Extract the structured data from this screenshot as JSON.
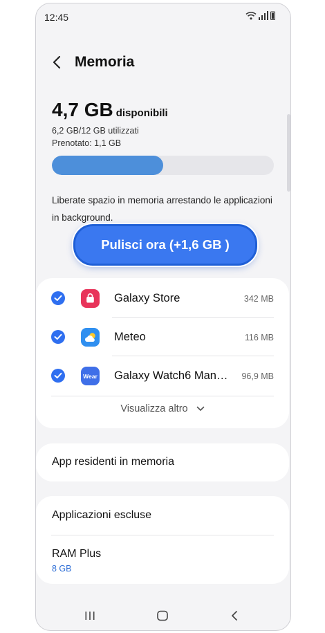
{
  "status_bar": {
    "time": "12:45"
  },
  "header": {
    "title": "Memoria"
  },
  "storage": {
    "available_value": "4,7 GB",
    "available_label": "disponibili",
    "used": "6,2 GB/12 GB utilizzati",
    "reserved": "Prenotato: 1,1 GB",
    "used_fraction": 0.5
  },
  "info_text": "Liberate spazio in memoria arrestando le applicazioni in background.",
  "clean_button": {
    "label": "Pulisci ora (+1,6 GB )"
  },
  "apps": [
    {
      "name": "Galaxy Store",
      "size": "342 MB",
      "icon": "galaxy-store-icon",
      "color": "#e8345a"
    },
    {
      "name": "Meteo",
      "size": "116 MB",
      "icon": "weather-icon",
      "color": "#2f8ff0"
    },
    {
      "name": "Galaxy Watch6 Manager",
      "size": "96,9 MB",
      "icon": "wear-icon",
      "color": "#3f6fe8",
      "icon_text": "Wear"
    }
  ],
  "show_more": "Visualizza altro",
  "settings": {
    "resident_apps": "App residenti in memoria",
    "excluded_apps": "Applicazioni escluse",
    "ram_plus": "RAM Plus",
    "ram_plus_value": "8 GB"
  },
  "colors": {
    "accent": "#3a78f0",
    "progress": "#4d8fda",
    "link": "#2f6fd6"
  }
}
